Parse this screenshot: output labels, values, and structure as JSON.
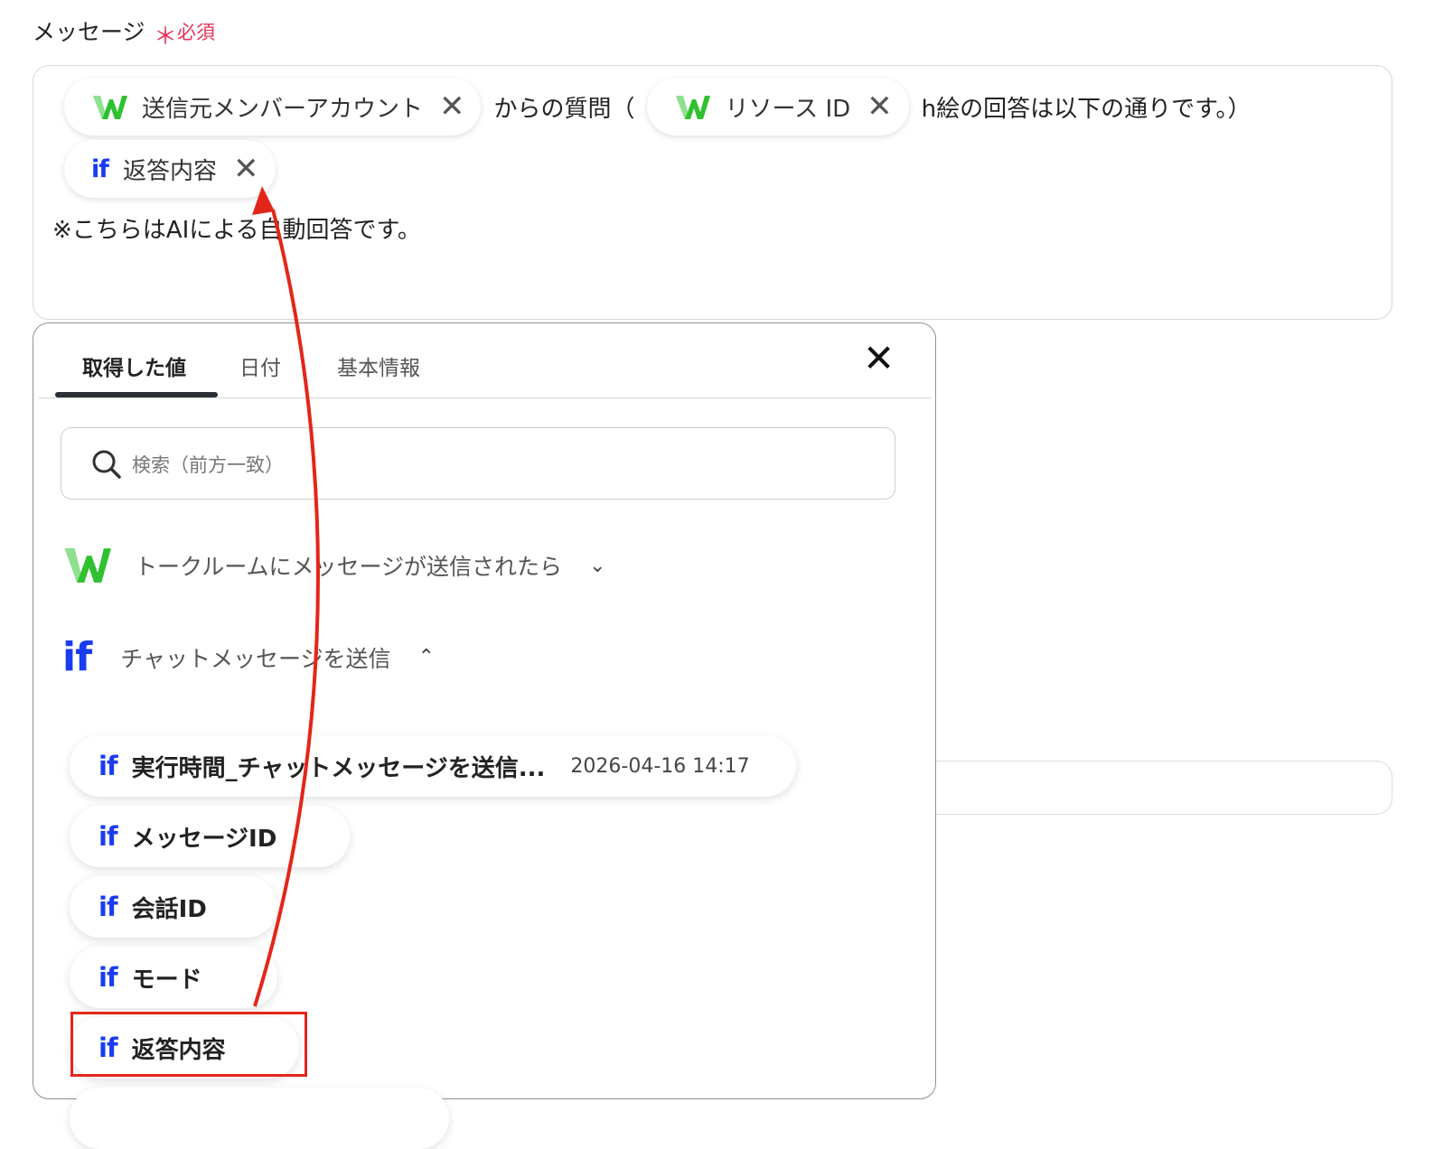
{
  "field": {
    "label": "メッセージ",
    "required_star": "＊",
    "required_text": "必須"
  },
  "message": {
    "chip_sender": "送信元メンバーアカウント",
    "text_from": "からの質問（",
    "chip_resource": "リソース ID",
    "text_answer": "h絵の回答は以下の通りです。）",
    "chip_response": "返答内容",
    "note": "※こちらはAIによる自動回答です。",
    "icon_if": "if",
    "close_glyph": "✕"
  },
  "panel": {
    "tabs": [
      "取得した値",
      "日付",
      "基本情報"
    ],
    "active_tab": "取得した値",
    "close_glyph": "✕",
    "search_placeholder": "検索（前方一致）",
    "group1_label": "トークルームにメッセージが送信されたら",
    "group1_chevron": "⌄",
    "group2_label": "チャットメッセージを送信",
    "group2_chevron": "⌃",
    "icon_if": "if",
    "items": [
      {
        "label": "実行時間_チャットメッセージを送信...",
        "value": "2026-04-16 14:17"
      },
      {
        "label": "メッセージID"
      },
      {
        "label": "会話ID"
      },
      {
        "label": "モード"
      },
      {
        "label": "返答内容"
      }
    ]
  },
  "colors": {
    "accent_if": "#1a3cf0",
    "required": "#e5325a",
    "annotation": "#e3261a",
    "brand_w_green": "#2fc12f"
  },
  "icons": [
    "search-icon",
    "close-icon",
    "chevron-down-icon",
    "chevron-up-icon",
    "w-logo-icon",
    "if-logo-icon"
  ]
}
